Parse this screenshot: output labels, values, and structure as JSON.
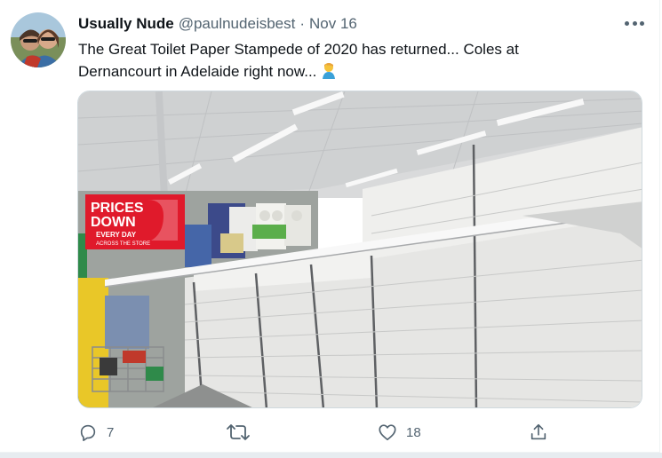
{
  "tweet": {
    "author_name": "Usually Nude",
    "handle": "@paulnudeisbest",
    "separator": "·",
    "date": "Nov 16",
    "text_line1": "The Great Toilet Paper Stampede of 2020 has returned... Coles at",
    "text_line2": "Dernancourt in Adelaide right now...",
    "emoji": "person-facepalming-emoji",
    "media": {
      "sign_line1": "PRICES",
      "sign_line2": "DOWN",
      "sign_line3": "EVERY DAY",
      "sign_line4": "ACROSS THE STORE"
    }
  },
  "actions": {
    "reply_icon": "reply-icon",
    "reply_count": "7",
    "retweet_icon": "retweet-icon",
    "like_icon": "heart-icon",
    "like_count": "18",
    "share_icon": "share-icon"
  },
  "colors": {
    "text_primary": "#0f1419",
    "text_secondary": "#536471",
    "border": "#cfd9de",
    "sign_red": "#e01a2b"
  }
}
